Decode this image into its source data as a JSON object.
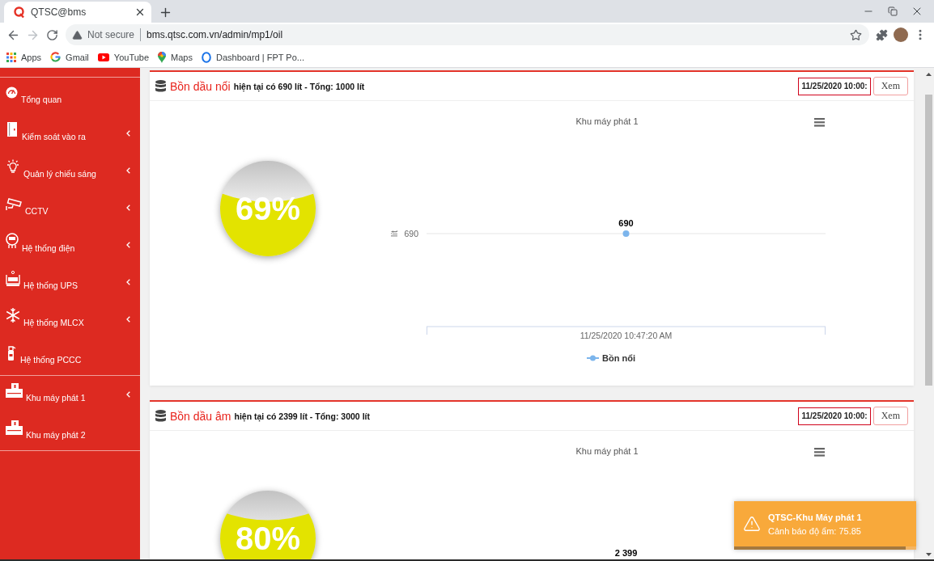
{
  "browser": {
    "tab": {
      "title": "QTSC@bms"
    },
    "nav": {
      "back": {
        "disabled": false
      },
      "forward": {
        "disabled": true
      }
    },
    "address": {
      "security": "Not secure",
      "url": "bms.qtsc.com.vn/admin/mp1/oil"
    },
    "bookmarks": [
      {
        "label": "Apps"
      },
      {
        "label": "Gmail"
      },
      {
        "label": "YouTube"
      },
      {
        "label": "Maps"
      },
      {
        "label": "Dashboard | FPT Po..."
      }
    ]
  },
  "sidebar": {
    "sections": [
      {
        "items": [
          {
            "label": "Tổng quan",
            "kind": "link"
          },
          {
            "label": "Kiểm soát vào ra",
            "kind": "submenu"
          },
          {
            "label": "Quản lý chiếu sáng",
            "kind": "submenu"
          },
          {
            "label": "CCTV",
            "kind": "submenu"
          },
          {
            "label": "Hệ thống điện",
            "kind": "submenu"
          },
          {
            "label": "Hệ thống UPS",
            "kind": "submenu"
          },
          {
            "label": "Hệ thống MLCX",
            "kind": "submenu"
          },
          {
            "label": "Hệ thống PCCC",
            "kind": "link"
          }
        ]
      },
      {
        "items": [
          {
            "label": "Khu máy phát 1",
            "kind": "submenu"
          },
          {
            "label": "Khu máy phát 2",
            "kind": "link"
          }
        ]
      }
    ]
  },
  "tanks": [
    {
      "title": "Bồn dầu nổi",
      "summary": "hiện tại có 690 lít - Tổng: 1000 lít",
      "date": "11/25/2020 10:00:",
      "button": "Xem",
      "gauge": {
        "level": 0.69,
        "reading": "69%"
      },
      "chart": {
        "title": "Khu máy phát 1",
        "axis_title": "lít",
        "tick_label": "690",
        "point_label": "690",
        "x_label": "11/25/2020 10:47:20 AM",
        "legend": "Bồn nổi"
      }
    },
    {
      "title": "Bồn dầu âm",
      "summary": "hiện tại có 2399 lít - Tổng: 3000 lít",
      "date": "11/25/2020 10:00:",
      "button": "Xem",
      "gauge": {
        "level": 0.8,
        "reading": "80%"
      },
      "chart": {
        "title": "Khu máy phát 1",
        "point_label": "2 399"
      }
    }
  ],
  "toast": {
    "title": "QTSC-Khu Máy phát 1",
    "message": "Cảnh báo độ ẩm: 75.85",
    "level": 0.94
  }
}
